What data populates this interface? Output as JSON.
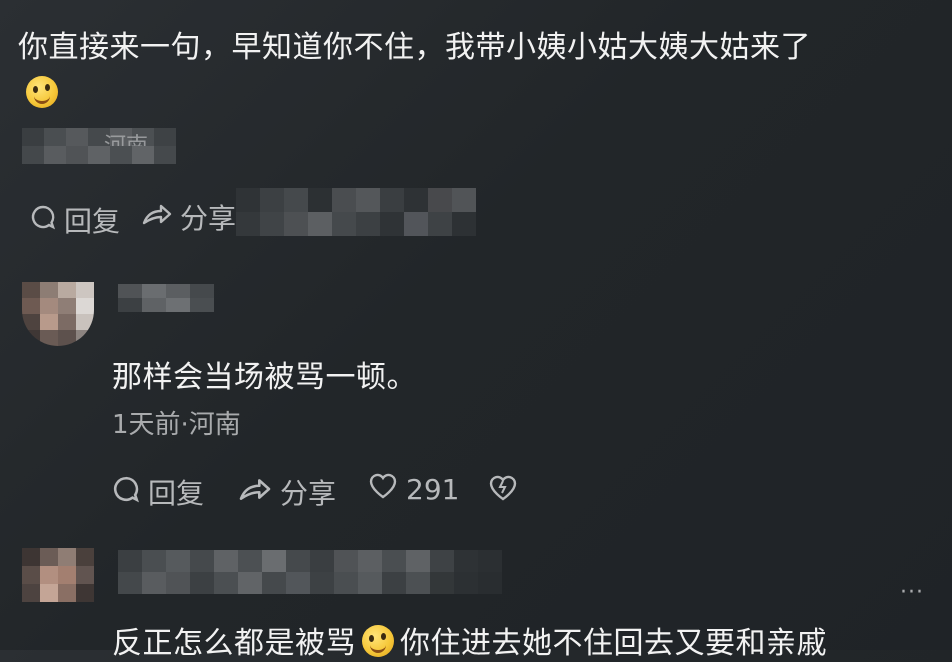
{
  "comment1": {
    "text": "你直接来一句，早知道你不住，我带小姨小姑大姨大姑来了",
    "emoji_icon": "smiling-face-emoji",
    "location_partial": "河南",
    "reply_label": "回复",
    "share_label_partial": "分享"
  },
  "comment2": {
    "text": "那样会当场被骂一顿。",
    "meta": "1天前·河南",
    "reply_label": "回复",
    "share_label": "分享",
    "like_count": "291"
  },
  "comment3": {
    "text_before_emoji": "反正怎么都是被骂",
    "text_after_emoji": "你住进去她不住回去又要和亲戚",
    "more_label": "···"
  },
  "colors": {
    "background": "#25292c",
    "text": "#f2f2f2",
    "meta": "#a9abad"
  }
}
